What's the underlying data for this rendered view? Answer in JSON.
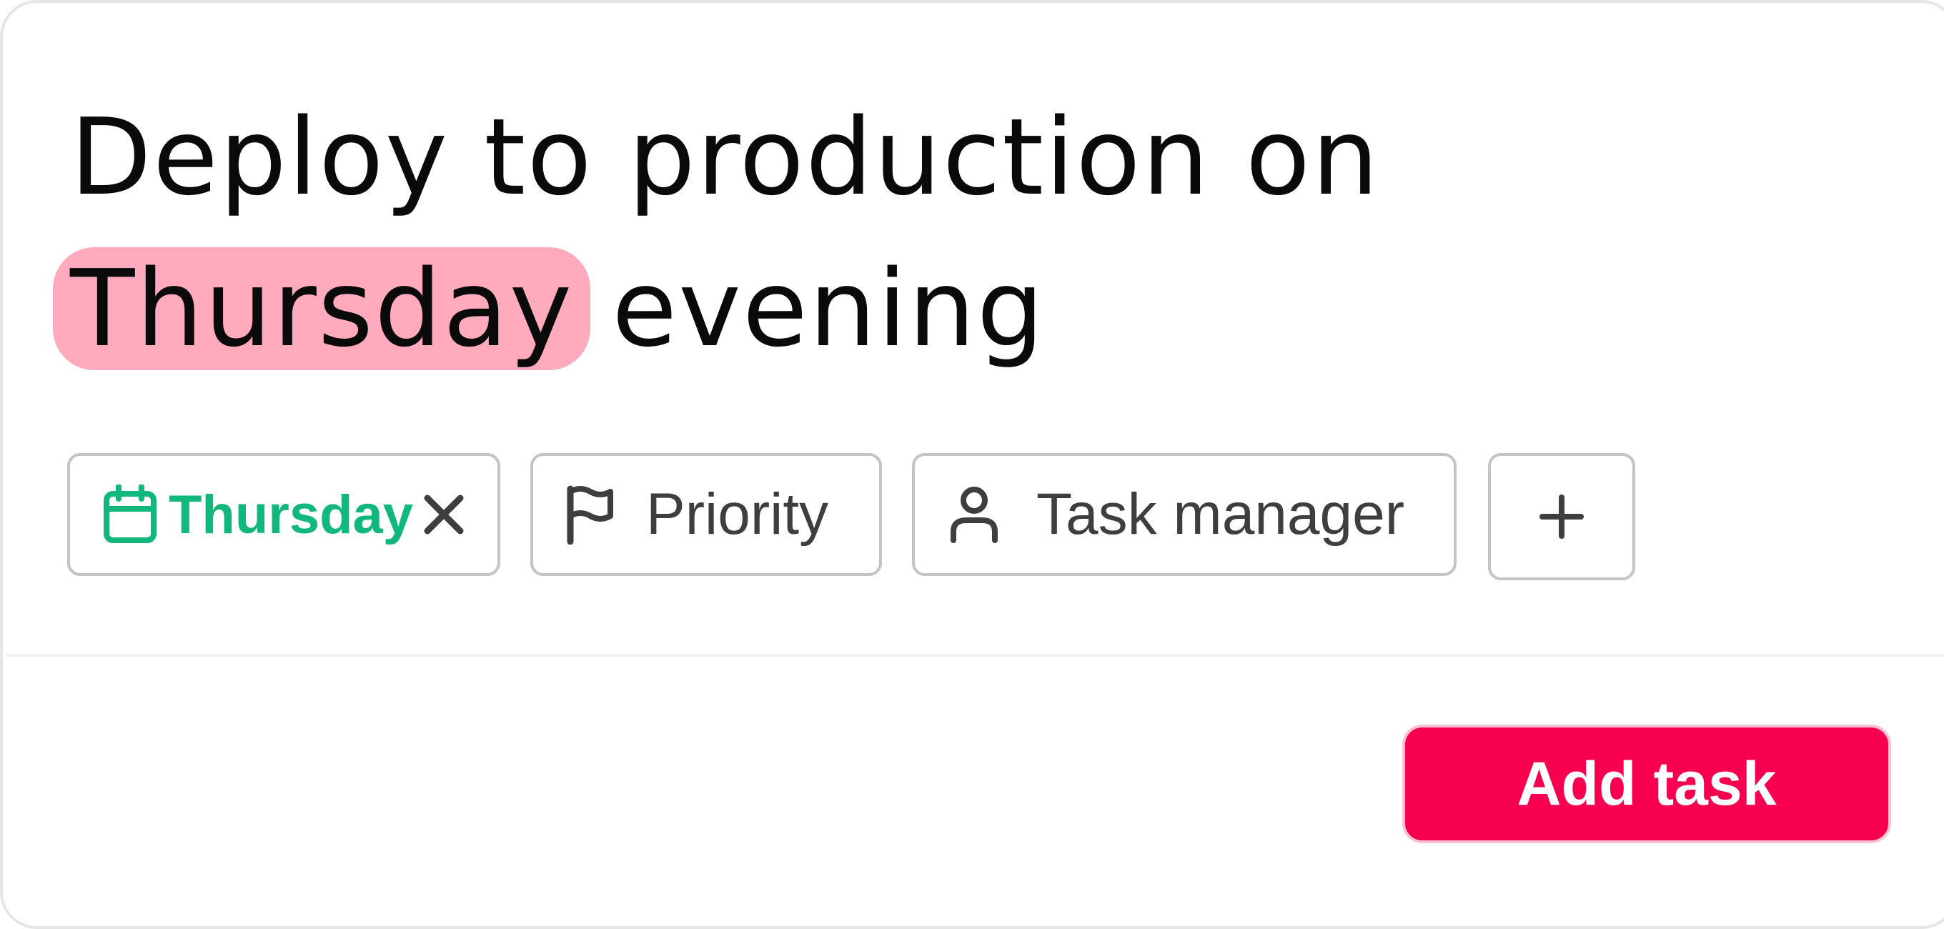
{
  "task": {
    "title_before": "Deploy to production on",
    "title_highlight": "Thursday",
    "title_after": "evening"
  },
  "chips": {
    "date": {
      "label": "Thursday",
      "icon": "calendar-icon",
      "remove_icon": "close-icon",
      "color": "#12b77c"
    },
    "priority": {
      "label": "Priority",
      "icon": "flag-icon"
    },
    "assignee": {
      "label": "Task manager",
      "icon": "person-icon"
    },
    "more": {
      "icon": "plus-icon"
    }
  },
  "actions": {
    "add_label": "Add task",
    "accent_color": "#f7004f"
  },
  "colors": {
    "highlight": "#ffaabd"
  }
}
